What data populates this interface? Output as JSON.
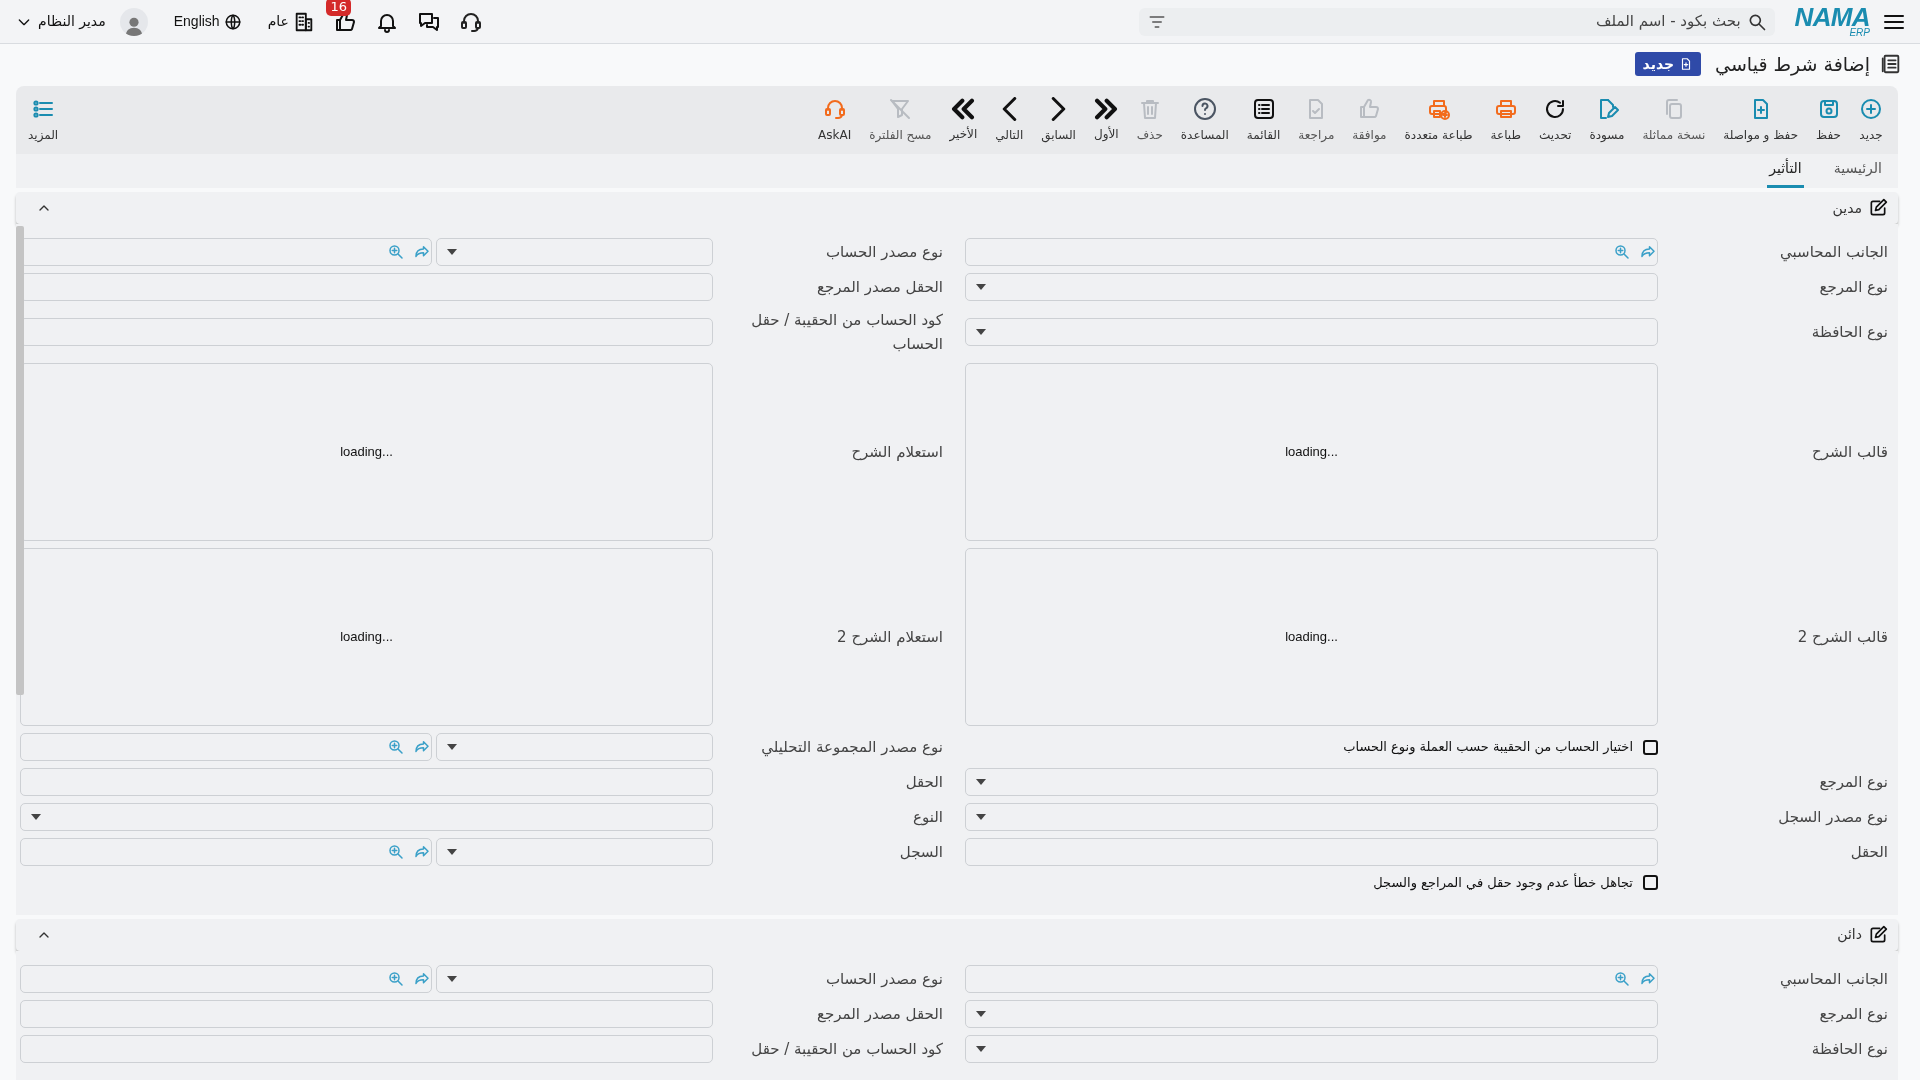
{
  "topbar": {
    "logo": "NAMA",
    "logo_sub": "ERP",
    "search": {
      "placeholder": "بحث بكود - اسم الملف"
    },
    "notifications_badge": "16",
    "company": "عام",
    "language": "English",
    "user": "مدير النظام"
  },
  "page": {
    "title": "إضافة شرط قياسي",
    "status_badge": "جديد"
  },
  "toolbar": [
    {
      "label": "جديد",
      "disabled": false,
      "color": "#1a8cb0"
    },
    {
      "label": "حفظ",
      "disabled": false,
      "color": "#1a8cb0"
    },
    {
      "label": "حفظ و مواصلة",
      "disabled": false,
      "color": "#1a8cb0"
    },
    {
      "label": "نسخة مماثلة",
      "disabled": true
    },
    {
      "label": "مسودة",
      "disabled": false,
      "color": "#1a8cb0"
    },
    {
      "label": "تحديث",
      "disabled": false,
      "color": "#111111"
    },
    {
      "label": "طباعة",
      "disabled": false,
      "color": "#f26b1d"
    },
    {
      "label": "طباعة متعددة",
      "disabled": false,
      "color": "#f26b1d"
    },
    {
      "label": "موافقة",
      "disabled": true
    },
    {
      "label": "مراجعة",
      "disabled": true
    },
    {
      "label": "القائمة",
      "disabled": false,
      "color": "#111111"
    },
    {
      "label": "المساعدة",
      "disabled": false,
      "color": "#4b5563"
    },
    {
      "label": "حذف",
      "disabled": true
    },
    {
      "label": "الأول",
      "disabled": false,
      "color": "#111111"
    },
    {
      "label": "السابق",
      "disabled": false,
      "color": "#111111"
    },
    {
      "label": "التالي",
      "disabled": false,
      "color": "#111111"
    },
    {
      "label": "الأخير",
      "disabled": false,
      "color": "#111111"
    },
    {
      "label": "مسح الفلترة",
      "disabled": true
    },
    {
      "label": "AskAI",
      "disabled": false,
      "color": "#f26b1d"
    }
  ],
  "more_button": "المزيد",
  "tabs": [
    {
      "label": "الرئيسية",
      "selected": false
    },
    {
      "label": "التأثير",
      "selected": true
    }
  ],
  "sections": [
    {
      "title": "مدين",
      "expanded": true,
      "rows": [
        {
          "right": {
            "kind": "lookup",
            "label": "الجانب المحاسبي"
          },
          "left": {
            "kind": "select_lookup",
            "label": "نوع مصدر الحساب"
          }
        },
        {
          "right": {
            "kind": "select",
            "label": "نوع المرجع"
          },
          "left": {
            "kind": "text",
            "label": "الحقل مصدر المرجع"
          }
        },
        {
          "right": {
            "kind": "select",
            "label": "نوع الحافظة"
          },
          "left": {
            "kind": "text",
            "label": "كود الحساب من الحقيبة / حقل الحساب"
          }
        },
        {
          "right": {
            "kind": "editor",
            "label": "قالب الشرح",
            "content": "loading..."
          },
          "left": {
            "kind": "editor",
            "label": "استعلام الشرح",
            "content": "loading..."
          }
        },
        {
          "right": {
            "kind": "editor",
            "label": "قالب الشرح 2",
            "content": "loading..."
          },
          "left": {
            "kind": "editor",
            "label": "استعلام الشرح 2",
            "content": "loading..."
          }
        },
        {
          "right": {
            "kind": "checkbox",
            "label": "اختيار الحساب من الحقيبة حسب العملة ونوع الحساب",
            "checked": false
          },
          "left": {
            "kind": "select_lookup",
            "label": "نوع مصدر المجموعة التحليلي"
          }
        },
        {
          "right": {
            "kind": "select",
            "label": "نوع المرجع"
          },
          "left": {
            "kind": "text",
            "label": "الحقل"
          }
        },
        {
          "right": {
            "kind": "select",
            "label": "نوع مصدر السجل"
          },
          "left": {
            "kind": "select",
            "label": "النوع"
          }
        },
        {
          "right": {
            "kind": "text",
            "label": "الحقل"
          },
          "left": {
            "kind": "select_lookup",
            "label": "السجل"
          }
        },
        {
          "right": {
            "kind": "checkbox",
            "label": "تجاهل خطأ عدم وجود حقل في المراجع والسجل",
            "checked": false
          }
        }
      ]
    },
    {
      "title": "دائن",
      "expanded": true,
      "rows": [
        {
          "right": {
            "kind": "lookup",
            "label": "الجانب المحاسبي"
          },
          "left": {
            "kind": "select_lookup",
            "label": "نوع مصدر الحساب"
          }
        },
        {
          "right": {
            "kind": "select",
            "label": "نوع المرجع"
          },
          "left": {
            "kind": "text",
            "label": "الحقل مصدر المرجع"
          }
        },
        {
          "right": {
            "kind": "select",
            "label": "نوع الحافظة"
          },
          "left": {
            "kind": "text",
            "label": "كود الحساب من الحقيبة / حقل"
          }
        }
      ]
    }
  ]
}
